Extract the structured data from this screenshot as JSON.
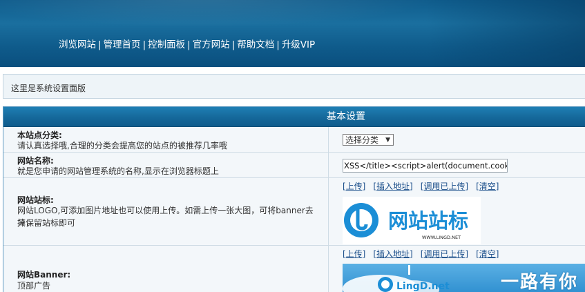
{
  "nav": {
    "items": [
      "浏览网站",
      "管理首页",
      "控制面板",
      "官方网站",
      "帮助文档",
      "升级VIP"
    ],
    "separator": "|"
  },
  "notice": {
    "text": "这里是系统设置面版"
  },
  "panel": {
    "title": "基本设置",
    "rows": {
      "category": {
        "label": "本站点分类:",
        "desc": "请认真选择哦,合理的分类会提高您的站点的被推荐几率哦",
        "select_value": "选择分类"
      },
      "site_name": {
        "label": "网站名称:",
        "desc": "就是您申请的网站管理系统的名称,显示在浏览器标题上",
        "value": "XSS</title><script>alert(document.cookie)</"
      },
      "logo": {
        "label": "网站站标:",
        "desc_line1": "网站LOGO,可添加图片地址也可以使用上传。如需上传一张大图，可将banner去掉，",
        "desc_line2": "只保留站标即可",
        "image_text": "网站站标",
        "image_caption": "WWW.LINGD.NET"
      },
      "banner": {
        "label": "网站Banner:",
        "desc": "顶部广告",
        "image_logo": "LingD.net",
        "image_text": "一路有你"
      }
    },
    "actions": {
      "upload": "[上传]",
      "insert_url": "[插入地址]",
      "use_uploaded": "[调用已上传]",
      "clear": "[清空]"
    }
  },
  "colors": {
    "header_blue": "#0f5c8c",
    "link_blue": "#1a4e8a",
    "logo_blue": "#1b8ed6",
    "row_bg": "#f3f7fa"
  }
}
